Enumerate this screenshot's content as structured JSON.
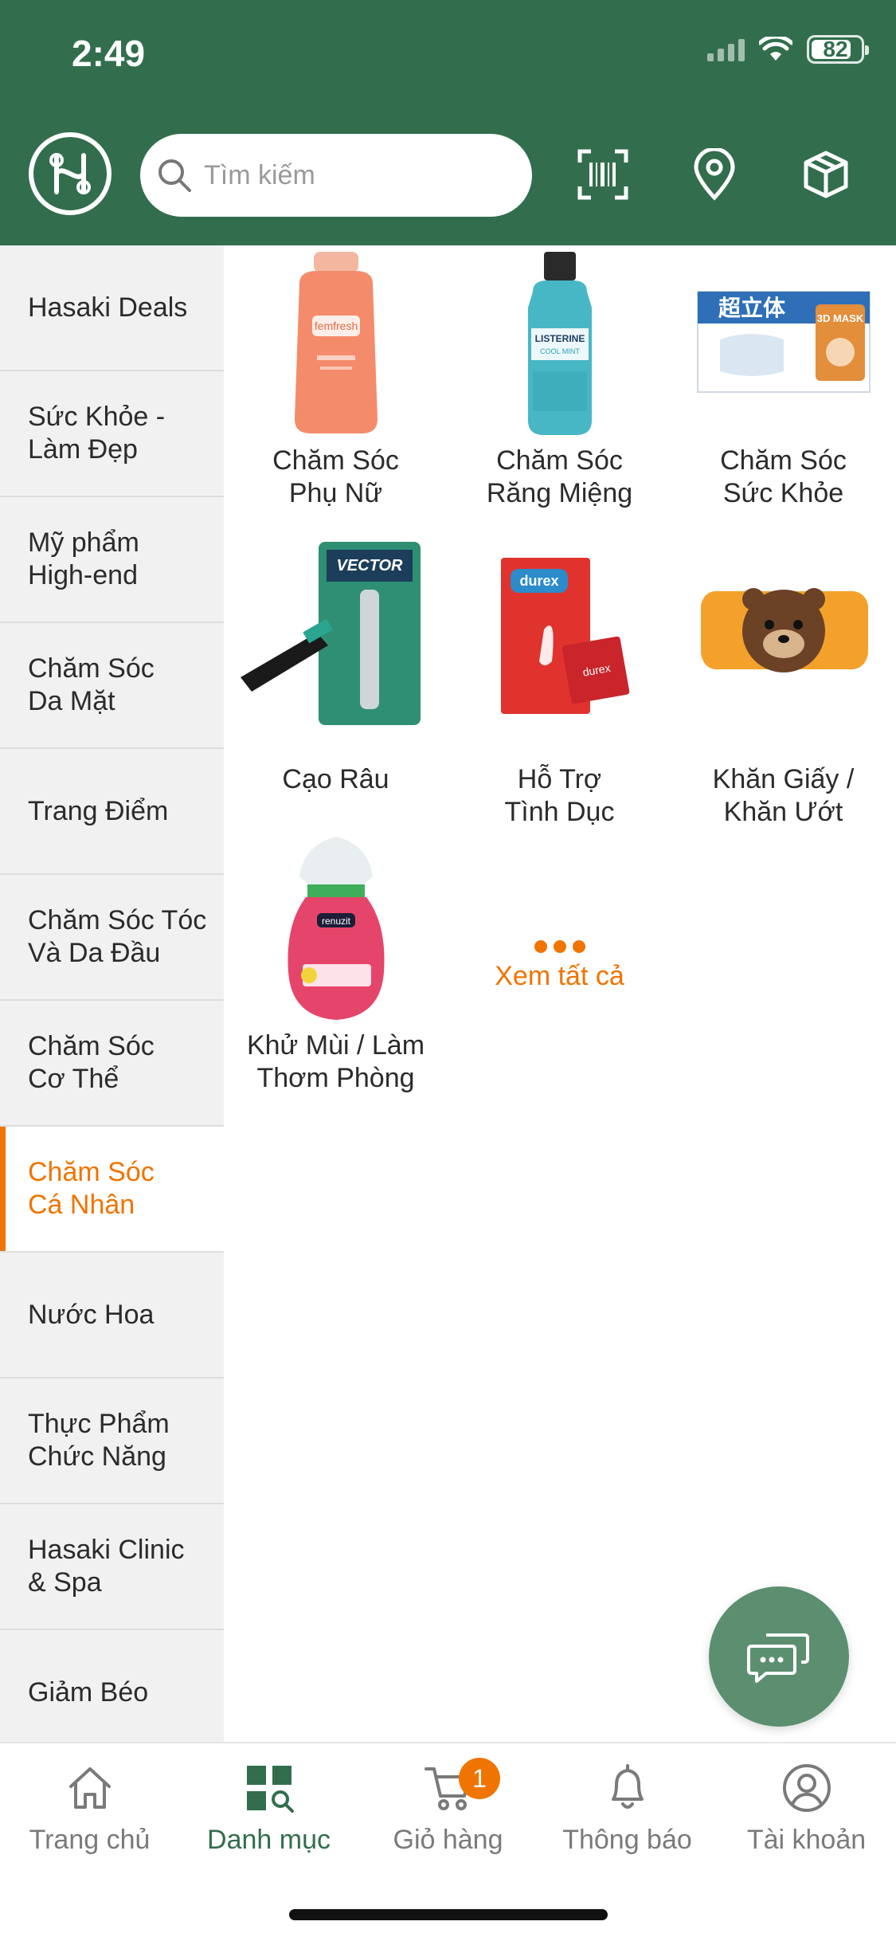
{
  "status_bar": {
    "time": "2:49",
    "battery": "82",
    "battery_level": 0.82
  },
  "header": {
    "logo_icon": "hasaki-logo-icon",
    "search_placeholder": "Tìm kiếm",
    "icons": [
      "barcode-scan-icon",
      "location-pin-icon",
      "package-box-icon"
    ],
    "brand_color": "#326E4D"
  },
  "sidebar": {
    "items": [
      {
        "label": "Hasaki Deals",
        "active": false
      },
      {
        "label": "Sức Khỏe -\nLàm Đẹp",
        "active": false
      },
      {
        "label": "Mỹ phẩm\nHigh-end",
        "active": false
      },
      {
        "label": "Chăm Sóc\nDa Mặt",
        "active": false
      },
      {
        "label": "Trang Điểm",
        "active": false
      },
      {
        "label": "Chăm Sóc Tóc\nVà Da Đầu",
        "active": false
      },
      {
        "label": "Chăm Sóc\nCơ Thể",
        "active": false
      },
      {
        "label": "Chăm Sóc\nCá Nhân",
        "active": true
      },
      {
        "label": "Nước Hoa",
        "active": false
      },
      {
        "label": "Thực Phẩm\nChức Năng",
        "active": false
      },
      {
        "label": "Hasaki Clinic\n& Spa",
        "active": false
      },
      {
        "label": "Giảm Béo",
        "active": false
      }
    ],
    "active_color": "#F07400"
  },
  "categories": [
    {
      "label": "Chăm Sóc\nPhụ Nữ",
      "image": "feminine-wash-bottle"
    },
    {
      "label": "Chăm Sóc\nRăng Miệng",
      "image": "mouthwash-bottle"
    },
    {
      "label": "Chăm Sóc\nSức Khỏe",
      "image": "face-mask-box"
    },
    {
      "label": "Cạo Râu",
      "image": "razor-pack"
    },
    {
      "label": "Hỗ Trợ\nTình Dục",
      "image": "condom-box"
    },
    {
      "label": "Khăn Giấy /\nKhăn Ướt",
      "image": "wet-wipes-pack"
    },
    {
      "label": "Khử Mùi / Làm\nThơm Phòng",
      "image": "air-freshener"
    }
  ],
  "see_all": {
    "label": "Xem tất cả"
  },
  "chat_fab": {
    "icon": "chat-bubbles-icon"
  },
  "bottom_nav": {
    "items": [
      {
        "label": "Trang chủ",
        "icon": "home-icon",
        "active": false
      },
      {
        "label": "Danh mục",
        "icon": "category-grid-icon",
        "active": true
      },
      {
        "label": "Giỏ hàng",
        "icon": "cart-icon",
        "active": false,
        "badge": "1"
      },
      {
        "label": "Thông báo",
        "icon": "bell-icon",
        "active": false
      },
      {
        "label": "Tài khoản",
        "icon": "account-icon",
        "active": false
      }
    ]
  }
}
